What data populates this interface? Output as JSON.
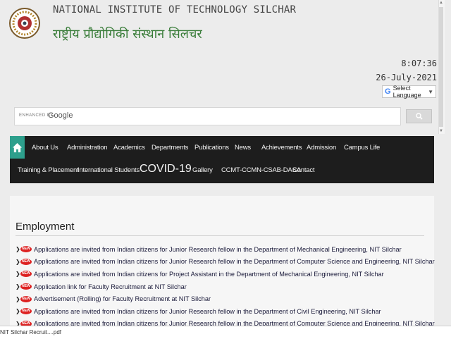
{
  "header": {
    "title_en": "NATIONAL INSTITUTE OF TECHNOLOGY SILCHAR",
    "title_hi": "राष्ट्रीय प्रौद्योगिकी संस्थान सिलचर",
    "time": "8:07:36",
    "date": "26-July-2021",
    "translate_label": "Select Language"
  },
  "search": {
    "enhanced_by": "ENHANCED BY",
    "google": "Google"
  },
  "nav": {
    "row1": [
      "About Us",
      "Administration",
      "Academics",
      "Departments",
      "Publications",
      "News",
      "Achievements",
      "Admission",
      "Campus Life"
    ],
    "row2": [
      "Training & Placement",
      "International Students",
      "COVID-19",
      "Gallery",
      "CCMT-CCMN-CSAB-DASA",
      "Contact"
    ]
  },
  "content": {
    "section_title": "Employment",
    "new_badge": "NEW",
    "items": [
      "Applications are invited from Indian citizens for Junior Research fellow in the Department of Mechanical Engineering, NIT Silchar",
      "Applications are invited from Indian citizens for Junior Research fellow in the Department of Computer Science and Engineering, NIT Silchar",
      "Applications are invited from Indian citizens for Project Assistant in the Department of Mechanical Engineering, NIT Silchar",
      "Application link for Faculty Recruitment at NIT Silchar",
      "Advertisement (Rolling) for Faculty Recruitment at NIT Silchar",
      "Applications are invited from Indian citizens for Junior Research fellow in the Department of Civil Engineering, NIT Silchar",
      "Applications are invited from Indian citizens for Junior Research fellow in the Department of Computer Science and Engineering, NIT Silchar"
    ]
  },
  "download": {
    "filename": "NIT Silchar Recruit....pdf"
  },
  "colors": {
    "nav_bg": "#1d1d1d",
    "home_bg": "#2d9f8c",
    "hindi_title": "#3a7d3a",
    "new_badge": "#d22222"
  }
}
